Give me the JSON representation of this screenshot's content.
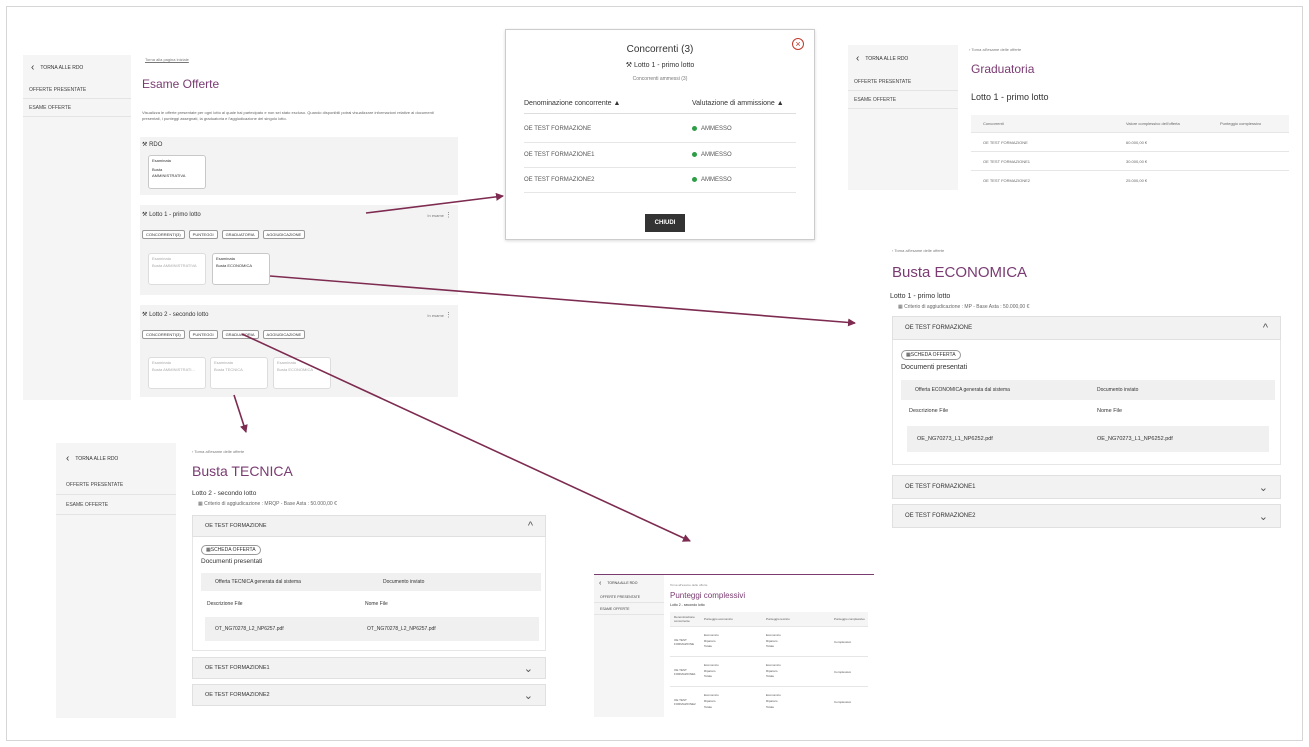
{
  "esame": {
    "back_rdo": "TORNA ALLE RDO",
    "menu": [
      "OFFERTE PRESENTATE",
      "ESAME OFFERTE"
    ],
    "breadcrumb": "Torna alla pagina iniziale",
    "title": "Esame Offerte",
    "description": "Visualizza le offerte presentate per ogni lotto al quale hai partecipato e non sei stato escluso. Quando disponibili potrai visualizzare informazioni relative ai documenti presentati, i punteggi assegnati, la graduatoria e l'aggiudicazione del singolo lotto.",
    "rdo_label": "RDO",
    "rdo_card": {
      "status": "Esaminata",
      "line1": "Busta",
      "line2": "AMMINISTRATIVA"
    },
    "lotto1": {
      "title": "Lotto 1 - primo lotto",
      "status": "In esame",
      "pills": [
        "CONCORRENTI(3)",
        "PUNTEGGI",
        "GRADUATORIA",
        "AGGIUDICAZIONE"
      ],
      "cards": [
        {
          "status": "Esaminata",
          "name": "Busta AMMINISTRATIVA"
        },
        {
          "status": "Esaminata",
          "name": "Busta ECONOMICA"
        }
      ]
    },
    "lotto2": {
      "title": "Lotto 2 - secondo lotto",
      "status": "In esame",
      "pills": [
        "CONCORRENTI(3)",
        "PUNTEGGI",
        "GRADUATORIA",
        "AGGIUDICAZIONE"
      ],
      "cards": [
        {
          "status": "Esaminata",
          "name": "Busta AMMINISTRATI..."
        },
        {
          "status": "Esaminata",
          "name": "Busta TECNICA"
        },
        {
          "status": "Esaminata",
          "name": "Busta ECONOMICA"
        }
      ]
    }
  },
  "concorrenti_modal": {
    "title": "Concorrenti (3)",
    "lotto": "Lotto 1 - primo lotto",
    "subtitle": "Concorrenti ammessi (3)",
    "col1": "Denominazione concorrente",
    "col2": "Valutazione di ammissione",
    "rows": [
      {
        "name": "OE TEST FORMAZIONE",
        "status": "AMMESSO"
      },
      {
        "name": "OE TEST FORMAZIONE1",
        "status": "AMMESSO"
      },
      {
        "name": "OE TEST FORMAZIONE2",
        "status": "AMMESSO"
      }
    ],
    "close_button": "CHIUDI"
  },
  "graduatoria": {
    "back_rdo": "TORNA ALLE RDO",
    "menu": [
      "OFFERTE PRESENTATE",
      "ESAME OFFERTE"
    ],
    "breadcrumb": "Torna all'esame delle offerte",
    "title": "Graduatoria",
    "lotto": "Lotto 1 - primo lotto",
    "columns": [
      "Concorrenti",
      "Valore complessivo dell'offerta",
      "Punteggio complessivo"
    ],
    "rows": [
      {
        "name": "OE TEST FORMAZIONE",
        "value": "60.000,00 €"
      },
      {
        "name": "OE TEST FORMAZIONE1",
        "value": "30.000,00 €"
      },
      {
        "name": "OE TEST FORMAZIONE2",
        "value": "25.000,00 €"
      }
    ]
  },
  "busta_economica": {
    "breadcrumb": "Torna all'esame delle offerte",
    "title": "Busta ECONOMICA",
    "lotto": "Lotto 1 - primo lotto",
    "criterio": "Criterio di aggiudicazione : MP - Base Asta : 50.000,00 €",
    "section_title": "OE TEST FORMAZIONE",
    "scheda_button": "SCHEDA OFFERTA",
    "docs_title": "Documenti presentati",
    "doc_col1": "Offerta ECONOMICA generata dal sistema",
    "doc_col2": "Documento inviato",
    "file_col1": "Descrizione File",
    "file_col2": "Nome File",
    "file_desc": "OE_NG70273_L1_NP6252.pdf",
    "file_name": "OE_NG70273_L1_NP6252.pdf",
    "collapsed": [
      "OE TEST FORMAZIONE1",
      "OE TEST FORMAZIONE2"
    ]
  },
  "busta_tecnica": {
    "back_rdo": "TORNA ALLE RDO",
    "menu": [
      "OFFERTE PRESENTATE",
      "ESAME OFFERTE"
    ],
    "breadcrumb": "Torna all'esame delle offerte",
    "title": "Busta TECNICA",
    "lotto": "Lotto 2 - secondo lotto",
    "criterio": "Criterio di aggiudicazione : MRQP - Base Asta : 50.000,00 €",
    "section_title": "OE TEST FORMAZIONE",
    "scheda_button": "SCHEDA OFFERTA",
    "docs_title": "Documenti presentati",
    "doc_col1": "Offerta TECNICA generata dal sistema",
    "doc_col2": "Documento inviato",
    "file_col1": "Descrizione File",
    "file_col2": "Nome File",
    "file_desc": "OT_NG70278_L2_NP6257.pdf",
    "file_name": "OT_NG70278_L2_NP6257.pdf",
    "collapsed": [
      "OE TEST FORMAZIONE1",
      "OE TEST FORMAZIONE2"
    ]
  },
  "punteggi": {
    "back_rdo": "TORNA ALLE RDO",
    "menu": [
      "OFFERTE PRESENTATE",
      "ESAME OFFERTE"
    ],
    "breadcrumb": "Torna all'esame delle offerte",
    "title": "Punteggi complessivi",
    "lotto": "Lotto 2 - secondo lotto",
    "columns": [
      "Denominazione concorrente",
      "Punteggio economico",
      "Punteggio tecnico",
      "Punteggio complessivo"
    ],
    "rows": [
      {
        "name": "OE TEST FORMAZIONE"
      },
      {
        "name": "OE TEST FORMAZIONE1"
      },
      {
        "name": "OE TEST FORMAZIONE2"
      }
    ],
    "sub": [
      "Economico",
      "Riparam.",
      "Totale"
    ],
    "total_label": "Complessivo"
  },
  "colors": {
    "accent": "#7a3b72",
    "arrow": "#7d2b50",
    "success": "#2e9e46"
  }
}
